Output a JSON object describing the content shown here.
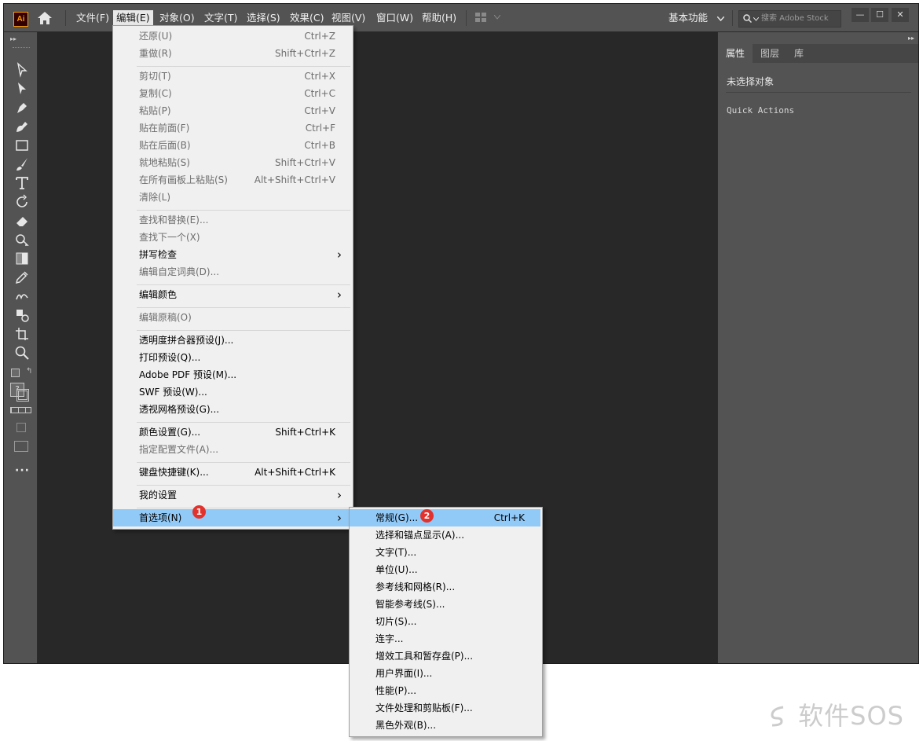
{
  "app": {
    "logo": "Ai",
    "menus": [
      "文件(F)",
      "编辑(E)",
      "对象(O)",
      "文字(T)",
      "选择(S)",
      "效果(C)",
      "视图(V)",
      "窗口(W)",
      "帮助(H)"
    ],
    "workspace": "基本功能",
    "search_placeholder": "搜索 Adobe Stock"
  },
  "panel": {
    "tabs": [
      "属性",
      "图层",
      "库"
    ],
    "no_selection": "未选择对象",
    "quick_actions": "Quick Actions"
  },
  "edit_menu": [
    {
      "label": "还原(U)",
      "shortcut": "Ctrl+Z",
      "disabled": true
    },
    {
      "label": "重做(R)",
      "shortcut": "Shift+Ctrl+Z",
      "disabled": true
    },
    {
      "label": "剪切(T)",
      "shortcut": "Ctrl+X",
      "disabled": true
    },
    {
      "label": "复制(C)",
      "shortcut": "Ctrl+C",
      "disabled": true
    },
    {
      "label": "粘贴(P)",
      "shortcut": "Ctrl+V",
      "disabled": true
    },
    {
      "label": "贴在前面(F)",
      "shortcut": "Ctrl+F",
      "disabled": true
    },
    {
      "label": "贴在后面(B)",
      "shortcut": "Ctrl+B",
      "disabled": true
    },
    {
      "label": "就地粘贴(S)",
      "shortcut": "Shift+Ctrl+V",
      "disabled": true
    },
    {
      "label": "在所有画板上粘贴(S)",
      "shortcut": "Alt+Shift+Ctrl+V",
      "disabled": true
    },
    {
      "label": "清除(L)",
      "shortcut": "",
      "disabled": true
    },
    {
      "label": "查找和替换(E)...",
      "shortcut": "",
      "disabled": true
    },
    {
      "label": "查找下一个(X)",
      "shortcut": "",
      "disabled": true
    },
    {
      "label": "拼写检查",
      "shortcut": "",
      "disabled": false
    },
    {
      "label": "编辑自定词典(D)...",
      "shortcut": "",
      "disabled": true
    },
    {
      "label": "编辑颜色",
      "shortcut": "",
      "disabled": false
    },
    {
      "label": "编辑原稿(O)",
      "shortcut": "",
      "disabled": true
    },
    {
      "label": "透明度拼合器预设(J)...",
      "shortcut": "",
      "disabled": false
    },
    {
      "label": "打印预设(Q)...",
      "shortcut": "",
      "disabled": false
    },
    {
      "label": "Adobe PDF 预设(M)...",
      "shortcut": "",
      "disabled": false
    },
    {
      "label": "SWF 预设(W)...",
      "shortcut": "",
      "disabled": false
    },
    {
      "label": "透视网格预设(G)...",
      "shortcut": "",
      "disabled": false
    },
    {
      "label": "颜色设置(G)...",
      "shortcut": "Shift+Ctrl+K",
      "disabled": false
    },
    {
      "label": "指定配置文件(A)...",
      "shortcut": "",
      "disabled": true
    },
    {
      "label": "键盘快捷键(K)...",
      "shortcut": "Alt+Shift+Ctrl+K",
      "disabled": false
    },
    {
      "label": "我的设置",
      "shortcut": "",
      "disabled": false
    },
    {
      "label": "首选项(N)",
      "shortcut": "",
      "disabled": false,
      "highlighted": true
    }
  ],
  "prefs_menu": [
    {
      "label": "常规(G)...",
      "shortcut": "Ctrl+K",
      "highlighted": true
    },
    {
      "label": "选择和锚点显示(A)...",
      "shortcut": ""
    },
    {
      "label": "文字(T)...",
      "shortcut": ""
    },
    {
      "label": "单位(U)...",
      "shortcut": ""
    },
    {
      "label": "参考线和网格(R)...",
      "shortcut": ""
    },
    {
      "label": "智能参考线(S)...",
      "shortcut": ""
    },
    {
      "label": "切片(S)...",
      "shortcut": ""
    },
    {
      "label": "连字...",
      "shortcut": ""
    },
    {
      "label": "增效工具和暂存盘(P)...",
      "shortcut": ""
    },
    {
      "label": "用户界面(I)...",
      "shortcut": ""
    },
    {
      "label": "性能(P)...",
      "shortcut": ""
    },
    {
      "label": "文件处理和剪贴板(F)...",
      "shortcut": ""
    },
    {
      "label": "黑色外观(B)...",
      "shortcut": ""
    }
  ],
  "badges": [
    "1",
    "2"
  ],
  "watermark": "软件SOS"
}
